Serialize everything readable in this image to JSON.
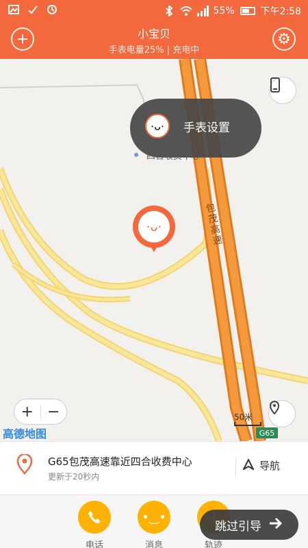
{
  "status_bar": {
    "battery": "55%",
    "time": "下午2:58"
  },
  "header": {
    "title": "小宝贝",
    "subtitle": "手表电量25% | 充电中",
    "add_label": "+",
    "gear_label": "⚙"
  },
  "tooltip": {
    "label": "手表设置"
  },
  "map": {
    "poi": "四合收费中心",
    "road_name": "包茂高速",
    "scale": "50米",
    "highway_badge": "G65",
    "logo": "高德地图",
    "zoom_in": "+",
    "zoom_out": "−"
  },
  "card": {
    "address": "G65包茂高速靠近四合收费中心",
    "updated": "更新于20秒内",
    "nav_label": "导航"
  },
  "tabs": [
    {
      "label": "电话"
    },
    {
      "label": "消息"
    },
    {
      "label": "轨迹"
    }
  ],
  "skip": {
    "label": "跳过引导"
  },
  "colors": {
    "accent": "#f4683d",
    "tab_yellow": "#ffb300",
    "highway_orange": "#f08c2e",
    "road_yellow": "#f5e07e"
  }
}
